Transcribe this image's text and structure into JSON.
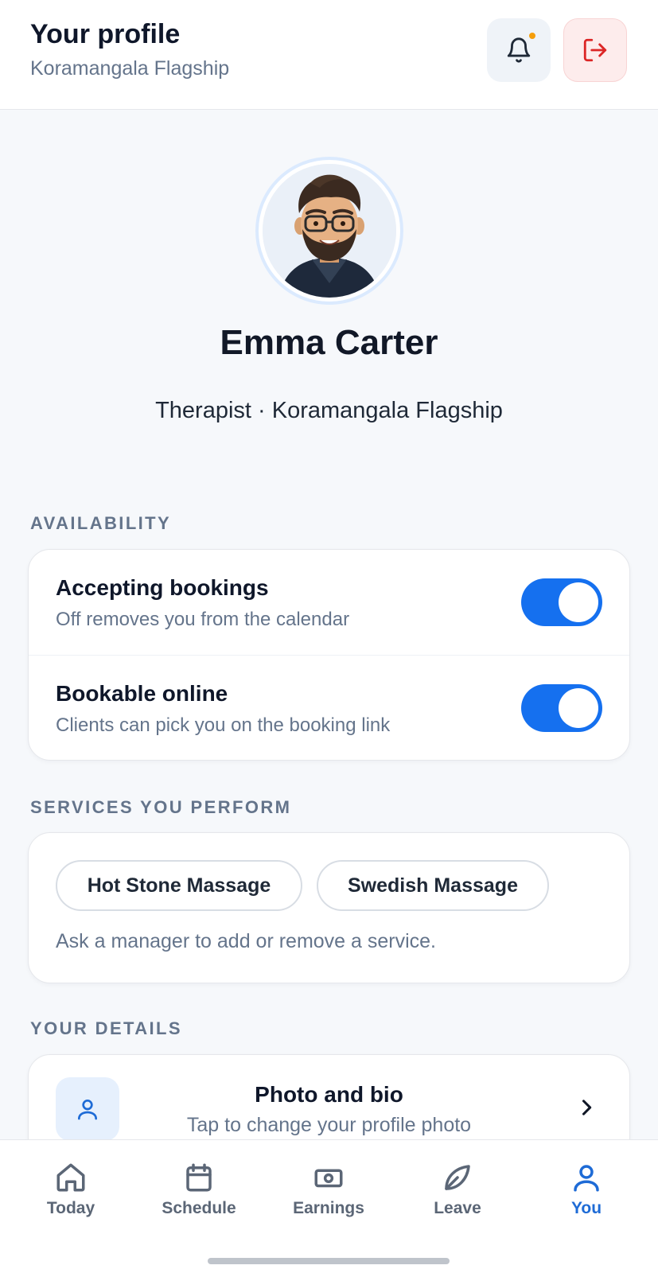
{
  "header": {
    "title": "Your profile",
    "subtitle": "Koramangala Flagship",
    "notifications_icon": "bell-icon",
    "logout_icon": "logout-icon",
    "notification_dot_color": "#f59e0b",
    "logout_color": "#dc2626"
  },
  "profile": {
    "name": "Emma Carter",
    "role_line": "Therapist · Koramangala Flagship"
  },
  "availability": {
    "label": "AVAILABILITY",
    "items": [
      {
        "title": "Accepting bookings",
        "subtitle": "Off removes you from the calendar",
        "on": true
      },
      {
        "title": "Bookable online",
        "subtitle": "Clients can pick you on the booking link",
        "on": true
      }
    ]
  },
  "services": {
    "label": "SERVICES YOU PERFORM",
    "chips": [
      "Hot Stone Massage",
      "Swedish Massage"
    ],
    "note": "Ask a manager to add or remove a service."
  },
  "details": {
    "label": "YOUR DETAILS",
    "items": [
      {
        "title": "Photo and bio",
        "subtitle": "Tap to change your profile photo",
        "icon": "user-icon"
      }
    ]
  },
  "tabbar": {
    "tabs": [
      {
        "label": "Today",
        "icon": "home-icon",
        "active": false
      },
      {
        "label": "Schedule",
        "icon": "calendar-icon",
        "active": false
      },
      {
        "label": "Earnings",
        "icon": "banknote-icon",
        "active": false
      },
      {
        "label": "Leave",
        "icon": "leaf-icon",
        "active": false
      },
      {
        "label": "You",
        "icon": "user-icon",
        "active": true
      }
    ]
  },
  "colors": {
    "accent": "#1570ef",
    "active_tab": "#1e6bd6"
  }
}
